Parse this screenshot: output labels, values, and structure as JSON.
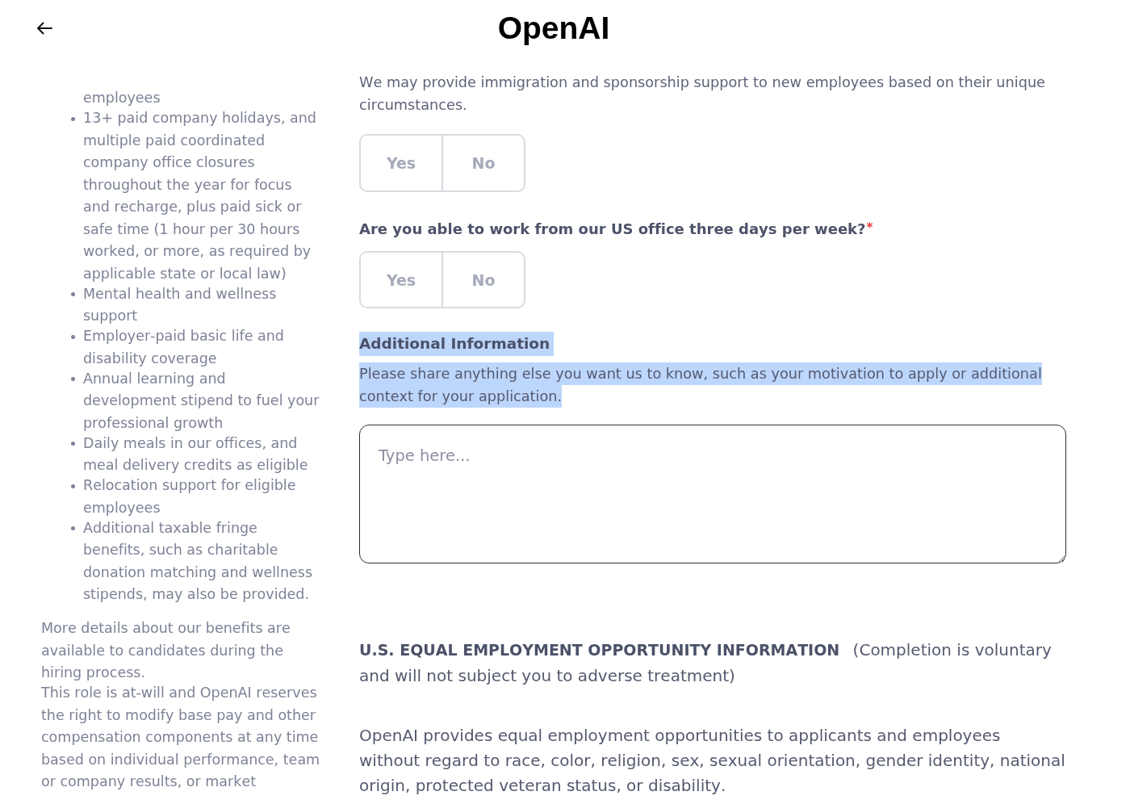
{
  "header": {
    "logo": "OpenAI"
  },
  "benefits": {
    "items": [
      {
        "kind": "continuation",
        "text": "employees"
      },
      {
        "kind": "bullet",
        "text": "13+ paid company holidays, and multiple paid coordinated company office closures throughout the year for focus and recharge, plus paid sick or safe time (1 hour per 30 hours worked, or more, as required by applicable state or local law)"
      },
      {
        "kind": "bullet",
        "text": "Mental health and wellness support"
      },
      {
        "kind": "bullet",
        "text": "Employer-paid basic life and disability coverage"
      },
      {
        "kind": "bullet",
        "text": "Annual learning and development stipend to fuel your professional growth"
      },
      {
        "kind": "bullet",
        "text": "Daily meals in our offices, and meal delivery credits as eligible"
      },
      {
        "kind": "bullet",
        "text": "Relocation support for eligible employees"
      },
      {
        "kind": "bullet",
        "text": "Additional taxable fringe benefits, such as charitable donation matching and wellness stipends, may also be provided."
      }
    ],
    "notes": [
      "More details about our benefits are available to candidates during the hiring process.",
      "This role is at-will and OpenAI reserves the right to modify base pay and other compensation components at any time based on individual performance, team or company results, or market"
    ]
  },
  "application_form": {
    "questions": [
      {
        "description": "We may provide immigration and sponsorship support to new employees based on their unique circumstances.",
        "options": [
          {
            "label": "Yes",
            "selected": false
          },
          {
            "label": "No",
            "selected": false
          }
        ]
      },
      {
        "label": "Are you able to work from our US office three days per week?",
        "required_mark": "*",
        "options": [
          {
            "label": "Yes",
            "selected": false
          },
          {
            "label": "No",
            "selected": false
          }
        ]
      }
    ],
    "additional_information": {
      "heading": "Additional Information",
      "heading_highlighted": true,
      "description": "Please share anything else you want us to know, such as your motivation to apply or additional context for your application.",
      "description_highlighted": true,
      "field": {
        "placeholder": "Type here..."
      }
    }
  },
  "eeo": {
    "heading": "**U.S. EQUAL EMPLOYMENT OPPORTUNITY INFORMATION** (Completion is voluntary and will not subject you to adverse treatment)",
    "statement": "OpenAI provides equal employment opportunities to applicants and employees without regard to race, color, religion, sex, sexual orientation, gender identity, national origin, protected veteran status, or disability."
  }
}
